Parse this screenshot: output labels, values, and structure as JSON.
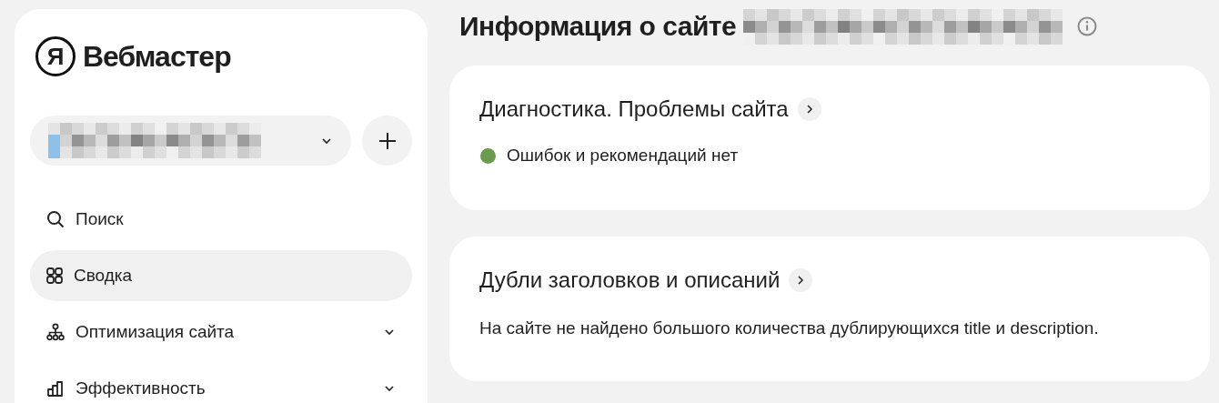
{
  "logo": {
    "mark": "Я",
    "title": "Вебмастер"
  },
  "site_selector": {
    "expanded": false
  },
  "nav": [
    {
      "label": "Поиск",
      "selected": false
    },
    {
      "label": "Сводка",
      "selected": true
    },
    {
      "label": "Оптимизация сайта",
      "selected": false,
      "expanded": false
    },
    {
      "label": "Эффективность",
      "selected": false,
      "expanded": false
    }
  ],
  "page_title": "Информация о сайте",
  "cards": [
    {
      "title": "Диагностика. Проблемы сайта",
      "kind": "status",
      "status": {
        "color": "#6a9a4e",
        "text": "Ошибок и рекомендаций нет"
      }
    },
    {
      "title": "Дубли заголовков и описаний",
      "kind": "text",
      "text": "На сайте не найдено большого количества дублирующихся title и description."
    }
  ]
}
